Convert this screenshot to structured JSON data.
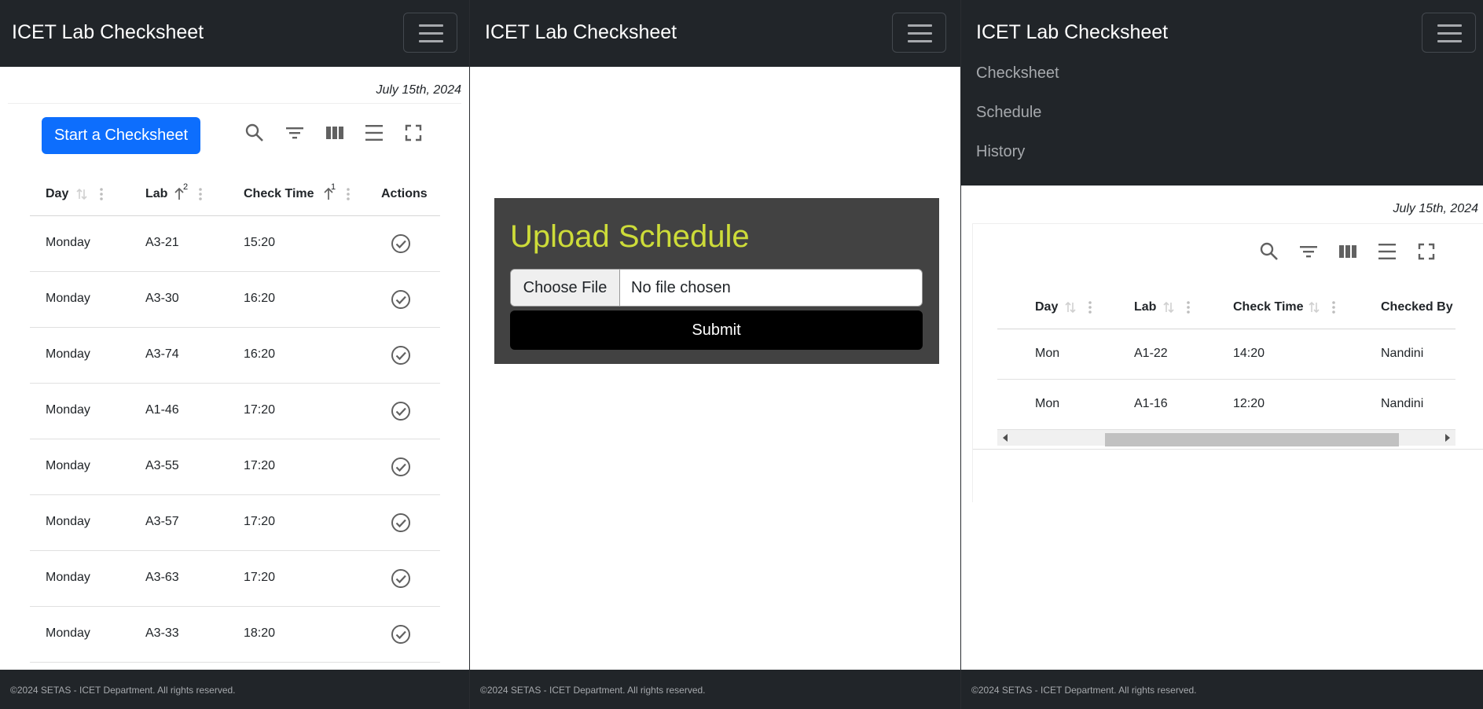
{
  "app": {
    "brand": "ICET Lab Checksheet",
    "footer": "©2024 SETAS - ICET Department. All rights reserved.",
    "date": "July 15th, 2024"
  },
  "left": {
    "start_button": "Start a Checksheet",
    "columns": [
      "Day",
      "Lab",
      "Check Time",
      "Actions"
    ],
    "sort_badges": {
      "lab": "2",
      "check_time": "1"
    },
    "rows": [
      [
        "Monday",
        "A3-21",
        "15:20"
      ],
      [
        "Monday",
        "A3-30",
        "16:20"
      ],
      [
        "Monday",
        "A3-74",
        "16:20"
      ],
      [
        "Monday",
        "A1-46",
        "17:20"
      ],
      [
        "Monday",
        "A3-55",
        "17:20"
      ],
      [
        "Monday",
        "A3-57",
        "17:20"
      ],
      [
        "Monday",
        "A3-63",
        "17:20"
      ],
      [
        "Monday",
        "A3-33",
        "18:20"
      ]
    ]
  },
  "middle": {
    "upload_title": "Upload Schedule",
    "choose_file": "Choose File",
    "no_file": "No file chosen",
    "submit": "Submit"
  },
  "right": {
    "menu": [
      "Checksheet",
      "Schedule",
      "History"
    ],
    "columns": [
      "Day",
      "Lab",
      "Check Time",
      "Checked By"
    ],
    "rows": [
      [
        "Mon",
        "A1-22",
        "14:20",
        "Nandini"
      ],
      [
        "Mon",
        "A1-16",
        "12:20",
        "Nandini"
      ]
    ]
  },
  "colors": {
    "navbar": "#212529",
    "primary": "#0d6efd",
    "upload_box": "#424242",
    "upload_title": "#cddc39"
  },
  "icons": [
    "search-icon",
    "filter-icon",
    "columns-icon",
    "density-icon",
    "fullscreen-icon",
    "sort-icon",
    "column-menu-icon",
    "check-circle-icon",
    "menu-icon"
  ]
}
